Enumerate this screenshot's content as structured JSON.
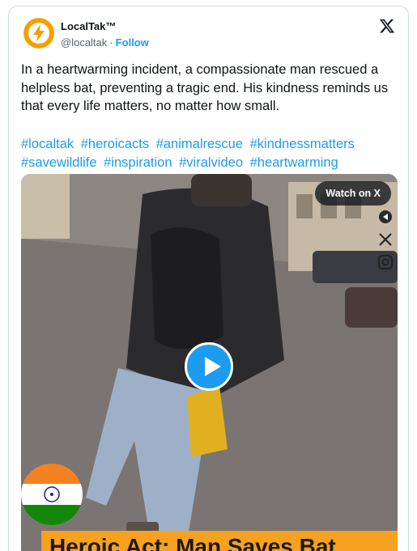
{
  "author": {
    "name": "LocalTak™",
    "handle": "@localtak",
    "separator": "·",
    "follow_label": "Follow"
  },
  "tweet": {
    "text": "In a heartwarming incident, a compassionate man rescued a helpless bat, preventing a tragic end. His kindness reminds us that every life matters, no matter how small.",
    "hashtags": [
      "#localtak",
      "#heroicacts",
      "#animalrescue",
      "#kindnessmatters",
      "#savewildlife",
      "#inspiration",
      "#viralvideo",
      "#heartwarming"
    ]
  },
  "media": {
    "watch_label": "Watch on X",
    "banner_text": "Heroic Act: Man Saves Bat",
    "side_icons": [
      "share-icon",
      "x-icon",
      "instagram-icon"
    ]
  },
  "colors": {
    "accent": "#1d9bf0",
    "banner": "#f6a11f"
  }
}
